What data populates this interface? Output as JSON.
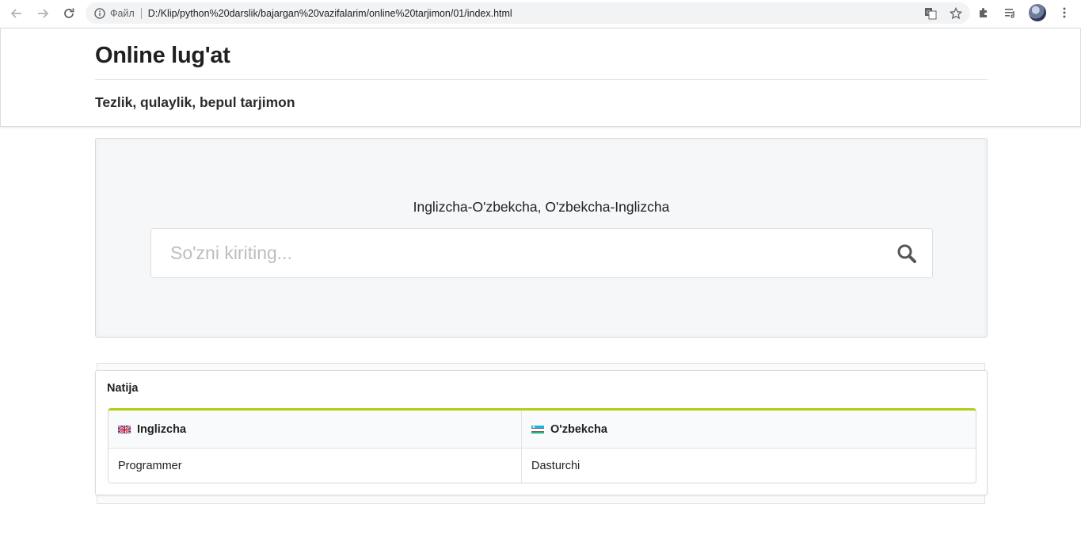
{
  "browser": {
    "scheme_label": "Файл",
    "url": "D:/Klip/python%20darslik/bajargan%20vazifalarim/online%20tarjimon/01/index.html"
  },
  "header": {
    "title": "Online lug'at",
    "subtitle": "Tezlik, qulaylik, bepul tarjimon"
  },
  "search": {
    "heading": "Inglizcha-O'zbekcha, O'zbekcha-Inglizcha",
    "placeholder": "So'zni kiriting...",
    "value": ""
  },
  "results": {
    "title": "Natija",
    "columns": [
      {
        "label": "Inglizcha",
        "flag": "uk-flag-icon"
      },
      {
        "label": "O'zbekcha",
        "flag": "uzbekistan-flag-icon"
      }
    ],
    "rows": [
      [
        "Programmer",
        "Dasturchi"
      ]
    ]
  },
  "colors": {
    "accent": "#b5cc18",
    "segment_bg": "#f6f7f8"
  }
}
